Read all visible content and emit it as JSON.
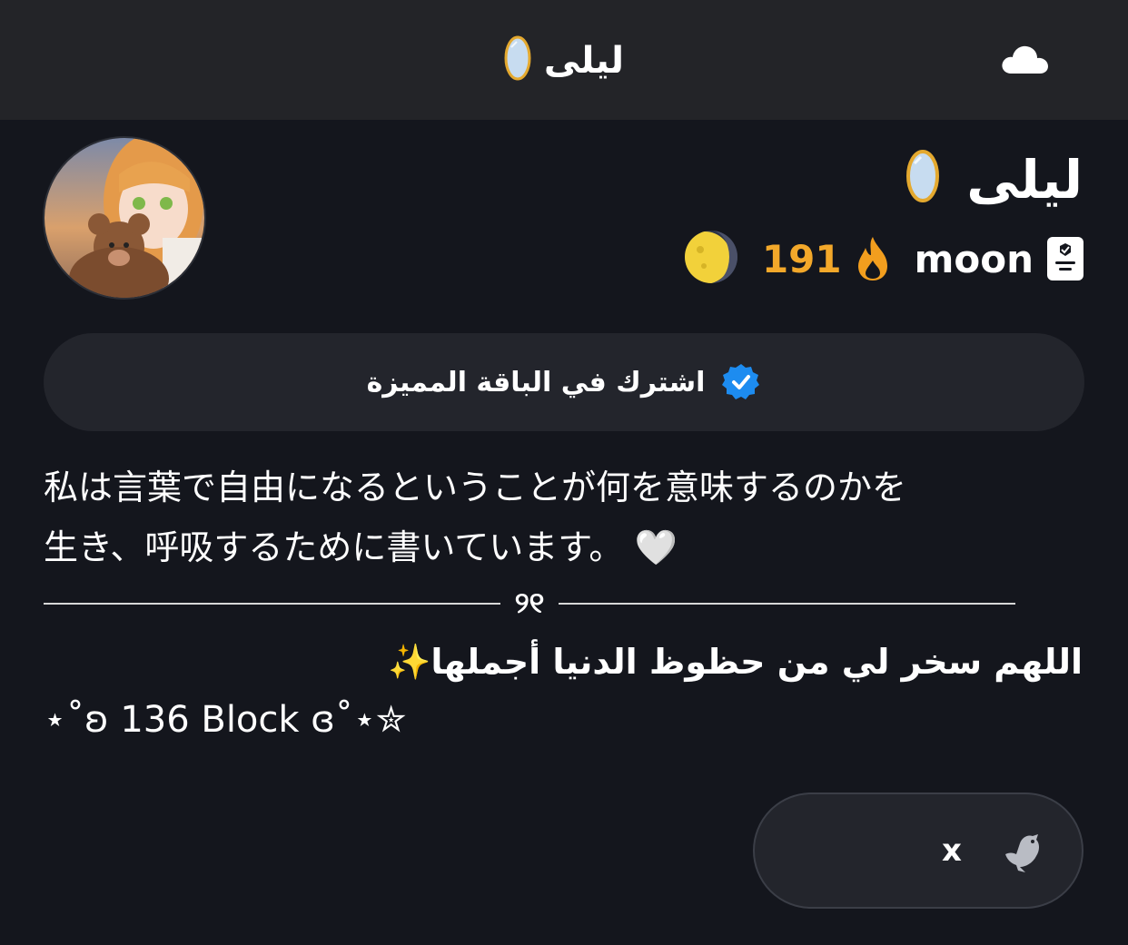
{
  "header": {
    "title": "ليلى",
    "title_icon": "mirror-icon",
    "action_icon": "cloud-icon"
  },
  "profile": {
    "avatar_icon": "avatar",
    "name": "ليلى",
    "name_icon": "mirror-icon",
    "badge_label": "moon",
    "badge_icon": "certificate-icon",
    "streak_count": "191",
    "streak_icon": "fire-icon",
    "mood_icon": "crescent-moon-icon"
  },
  "subscribe": {
    "label": "اشترك في الباقة المميزة",
    "icon": "verified-badge-icon",
    "accent": "#1d8cf0"
  },
  "bio": {
    "jp_text": "私は言葉で自由になるということが何を意味するのかを\n生き、呼吸するために書いています。 🤍",
    "divider_mid": "୨୧",
    "ar_text": "اللهم سخر لي من حظوظ الدنيا أجملها✨",
    "block_text": "⋆˚ʚ 136 Block ɞ˚⋆✮"
  },
  "link": {
    "label": "x",
    "icon": "bird-icon"
  },
  "colors": {
    "background": "#14161d",
    "header": "#232428",
    "surface": "#23252c",
    "streak": "#f3a82a"
  }
}
